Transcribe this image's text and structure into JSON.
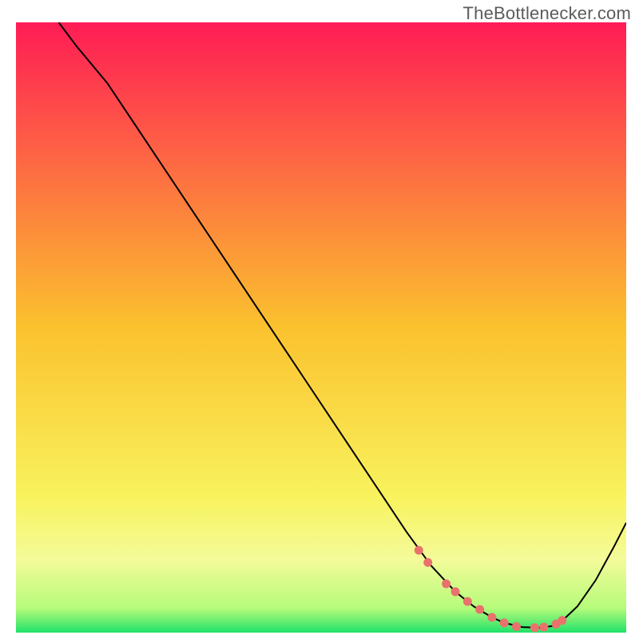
{
  "attribution": "TheBottlenecker.com",
  "chart_data": {
    "type": "line",
    "title": "",
    "xlabel": "",
    "ylabel": "",
    "xlim": [
      0,
      100
    ],
    "ylim": [
      0,
      100
    ],
    "gradient_stops": [
      {
        "offset": 0.0,
        "color": "#ff1c55"
      },
      {
        "offset": 0.5,
        "color": "#fbc22e"
      },
      {
        "offset": 0.78,
        "color": "#f8f35e"
      },
      {
        "offset": 0.88,
        "color": "#f4fb9a"
      },
      {
        "offset": 0.96,
        "color": "#b6fb7a"
      },
      {
        "offset": 1.0,
        "color": "#20e26a"
      }
    ],
    "series": [
      {
        "name": "curve",
        "x": [
          7,
          10,
          15,
          20,
          25,
          30,
          35,
          40,
          45,
          50,
          55,
          60,
          64,
          68,
          72,
          75,
          78,
          80,
          83,
          86,
          88,
          90,
          92,
          95,
          98,
          100
        ],
        "y": [
          100,
          96,
          90,
          82.5,
          75,
          67.5,
          60,
          52.5,
          45,
          37.5,
          30,
          22.5,
          16.5,
          11,
          6.7,
          4.3,
          2.5,
          1.6,
          0.9,
          0.8,
          1.1,
          2.4,
          4.3,
          8.6,
          14.1,
          18
        ]
      }
    ],
    "markers": {
      "name": "highlight-points",
      "color": "#e9736c",
      "x": [
        66,
        67.5,
        70.5,
        72,
        74,
        76,
        78,
        80,
        82,
        85,
        86.5,
        88.5,
        89.5
      ],
      "y": [
        13.5,
        11.5,
        8.0,
        6.7,
        5.1,
        3.8,
        2.5,
        1.6,
        1.0,
        0.8,
        0.9,
        1.4,
        2.0
      ]
    }
  }
}
